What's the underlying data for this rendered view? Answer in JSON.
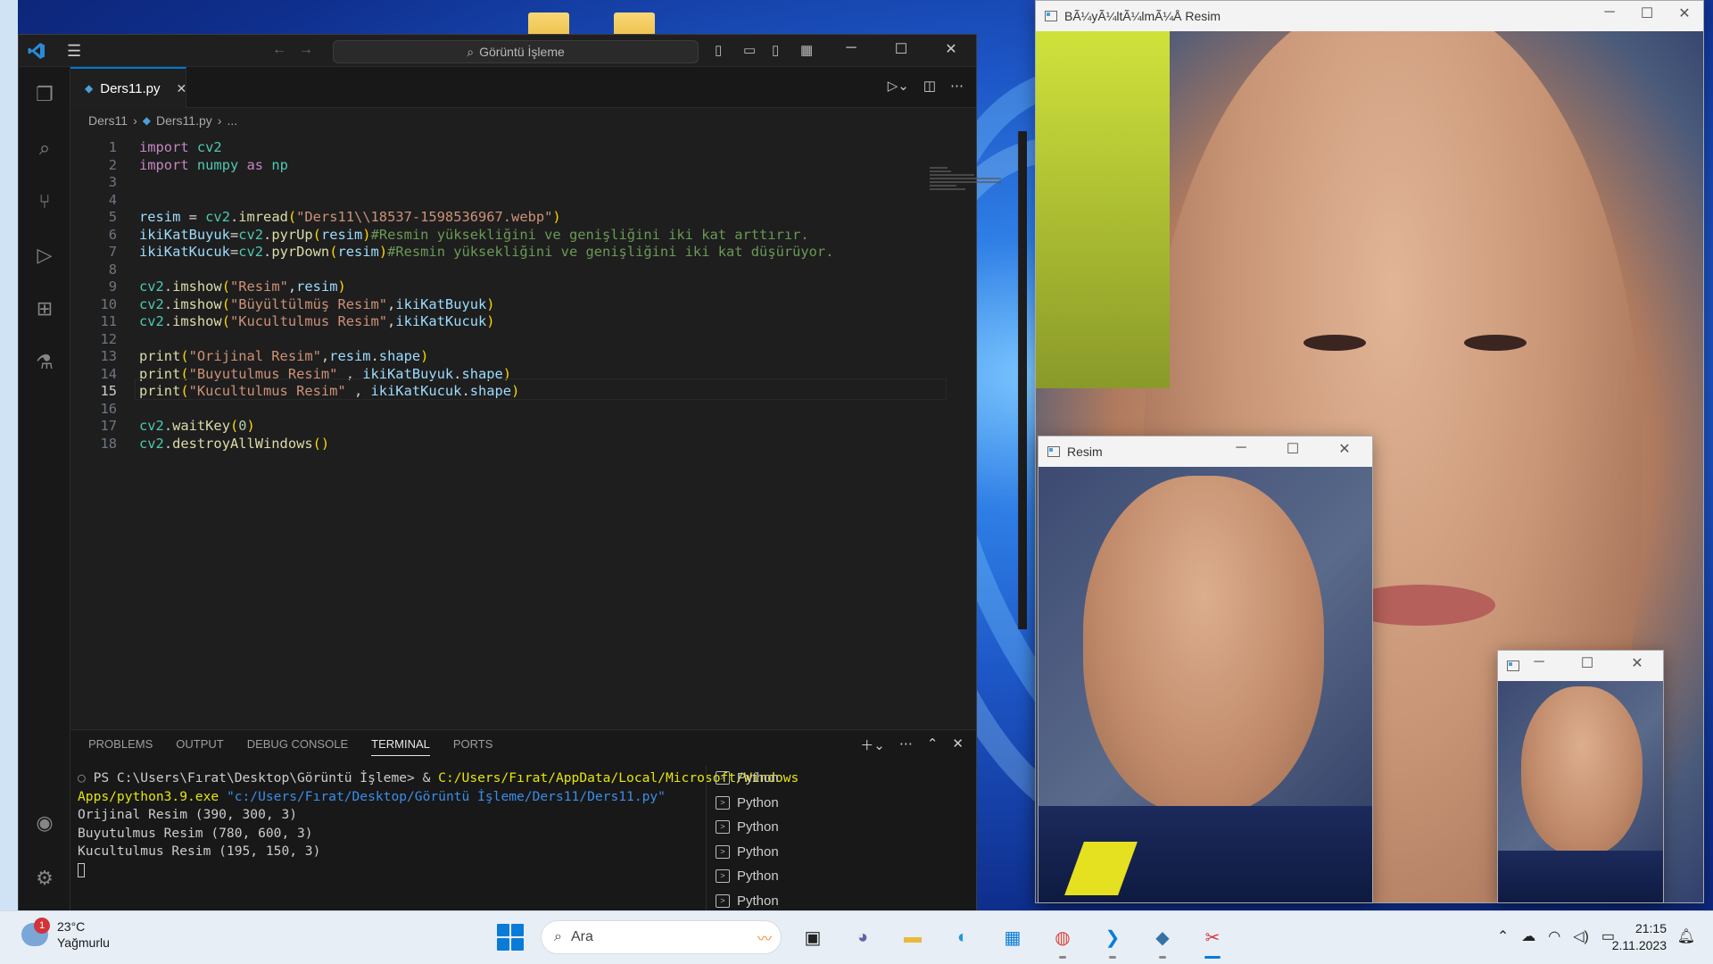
{
  "vscode": {
    "search_label": "Görüntü İşleme",
    "tab_label": "Ders11.py",
    "breadcrumb": [
      "Ders11",
      "Ders11.py",
      "..."
    ],
    "code_lines": [
      {
        "n": "1",
        "tokens": [
          [
            "kw",
            "import"
          ],
          [
            "pl",
            " "
          ],
          [
            "mod",
            "cv2"
          ]
        ]
      },
      {
        "n": "2",
        "tokens": [
          [
            "kw",
            "import"
          ],
          [
            "pl",
            " "
          ],
          [
            "mod",
            "numpy"
          ],
          [
            "pl",
            " "
          ],
          [
            "kw",
            "as"
          ],
          [
            "pl",
            " "
          ],
          [
            "mod",
            "np"
          ]
        ]
      },
      {
        "n": "3",
        "tokens": []
      },
      {
        "n": "4",
        "tokens": []
      },
      {
        "n": "5",
        "tokens": [
          [
            "var",
            "resim"
          ],
          [
            "pl",
            " = "
          ],
          [
            "mod",
            "cv2"
          ],
          [
            "pl",
            "."
          ],
          [
            "fn",
            "imread"
          ],
          [
            "br",
            "("
          ],
          [
            "str",
            "\"Ders11\\\\18537-1598536967.webp\""
          ],
          [
            "br",
            ")"
          ]
        ]
      },
      {
        "n": "6",
        "tokens": [
          [
            "var",
            "ikiKatBuyuk"
          ],
          [
            "pl",
            "="
          ],
          [
            "mod",
            "cv2"
          ],
          [
            "pl",
            "."
          ],
          [
            "fn",
            "pyrUp"
          ],
          [
            "br",
            "("
          ],
          [
            "var",
            "resim"
          ],
          [
            "br",
            ")"
          ],
          [
            "cm",
            "#Resmin yüksekliğini ve genişliğini iki kat arttırır."
          ]
        ]
      },
      {
        "n": "7",
        "tokens": [
          [
            "var",
            "ikiKatKucuk"
          ],
          [
            "pl",
            "="
          ],
          [
            "mod",
            "cv2"
          ],
          [
            "pl",
            "."
          ],
          [
            "fn",
            "pyrDown"
          ],
          [
            "br",
            "("
          ],
          [
            "var",
            "resim"
          ],
          [
            "br",
            ")"
          ],
          [
            "cm",
            "#Resmin yüksekliğini ve genişliğini iki kat düşürüyor."
          ]
        ]
      },
      {
        "n": "8",
        "tokens": []
      },
      {
        "n": "9",
        "tokens": [
          [
            "mod",
            "cv2"
          ],
          [
            "pl",
            "."
          ],
          [
            "fn",
            "imshow"
          ],
          [
            "br",
            "("
          ],
          [
            "str",
            "\"Resim\""
          ],
          [
            "pl",
            ","
          ],
          [
            "var",
            "resim"
          ],
          [
            "br",
            ")"
          ]
        ]
      },
      {
        "n": "10",
        "tokens": [
          [
            "mod",
            "cv2"
          ],
          [
            "pl",
            "."
          ],
          [
            "fn",
            "imshow"
          ],
          [
            "br",
            "("
          ],
          [
            "str",
            "\"Büyültülmüş Resim\""
          ],
          [
            "pl",
            ","
          ],
          [
            "var",
            "ikiKatBuyuk"
          ],
          [
            "br",
            ")"
          ]
        ]
      },
      {
        "n": "11",
        "tokens": [
          [
            "mod",
            "cv2"
          ],
          [
            "pl",
            "."
          ],
          [
            "fn",
            "imshow"
          ],
          [
            "br",
            "("
          ],
          [
            "str",
            "\"Kucultulmus Resim\""
          ],
          [
            "pl",
            ","
          ],
          [
            "var",
            "ikiKatKucuk"
          ],
          [
            "br",
            ")"
          ]
        ]
      },
      {
        "n": "12",
        "tokens": []
      },
      {
        "n": "13",
        "tokens": [
          [
            "fn",
            "print"
          ],
          [
            "br",
            "("
          ],
          [
            "str",
            "\"Orijinal Resim\""
          ],
          [
            "pl",
            ","
          ],
          [
            "var",
            "resim"
          ],
          [
            "pl",
            "."
          ],
          [
            "var",
            "shape"
          ],
          [
            "br",
            ")"
          ]
        ]
      },
      {
        "n": "14",
        "tokens": [
          [
            "fn",
            "print"
          ],
          [
            "br",
            "("
          ],
          [
            "str",
            "\"Buyutulmus Resim\""
          ],
          [
            "pl",
            " , "
          ],
          [
            "var",
            "ikiKatBuyuk"
          ],
          [
            "pl",
            "."
          ],
          [
            "var",
            "shape"
          ],
          [
            "br",
            ")"
          ]
        ]
      },
      {
        "n": "15",
        "tokens": [
          [
            "fn",
            "print"
          ],
          [
            "br",
            "("
          ],
          [
            "str",
            "\"Kucultulmus Resim\""
          ],
          [
            "pl",
            " , "
          ],
          [
            "var",
            "ikiKatKucuk"
          ],
          [
            "pl",
            "."
          ],
          [
            "var",
            "shape"
          ],
          [
            "br",
            ")"
          ]
        ]
      },
      {
        "n": "16",
        "tokens": []
      },
      {
        "n": "17",
        "tokens": [
          [
            "mod",
            "cv2"
          ],
          [
            "pl",
            "."
          ],
          [
            "fn",
            "waitKey"
          ],
          [
            "br",
            "("
          ],
          [
            "num",
            "0"
          ],
          [
            "br",
            ")"
          ]
        ]
      },
      {
        "n": "18",
        "tokens": [
          [
            "mod",
            "cv2"
          ],
          [
            "pl",
            "."
          ],
          [
            "fn",
            "destroyAllWindows"
          ],
          [
            "br",
            "()"
          ]
        ]
      }
    ],
    "current_line": "15",
    "panel_tabs": [
      "PROBLEMS",
      "OUTPUT",
      "DEBUG CONSOLE",
      "TERMINAL",
      "PORTS"
    ],
    "active_panel_tab": "TERMINAL",
    "terminal": {
      "prompt": "PS C:\\Users\\Fırat\\Desktop\\Görüntü İşleme> & ",
      "exe_path_1": "C:/Users/Fırat/AppData/Local/Microsoft/Windows",
      "exe_path_2": "Apps/python3.9.exe",
      "script_path": " \"c:/Users/Fırat/Desktop/Görüntü İşleme/Ders11/Ders11.py\"",
      "out_1": "Orijinal Resim (390, 300, 3)",
      "out_2": "Buyutulmus Resim (780, 600, 3)",
      "out_3": "Kucultulmus Resim (195, 150, 3)"
    },
    "terminal_list": [
      "Python",
      "Python",
      "Python",
      "Python",
      "Python",
      "Python"
    ]
  },
  "windows": {
    "big_title": "BÃ¼yÃ¼ltÃ¼lmÃ¼Å Resim",
    "mid_title": "Resim",
    "small_title": ""
  },
  "taskbar": {
    "weather_temp": "23°C",
    "weather_desc": "Yağmurlu",
    "weather_badge": "1",
    "search_placeholder": "Ara",
    "time": "21:15",
    "date": "2.11.2023"
  }
}
